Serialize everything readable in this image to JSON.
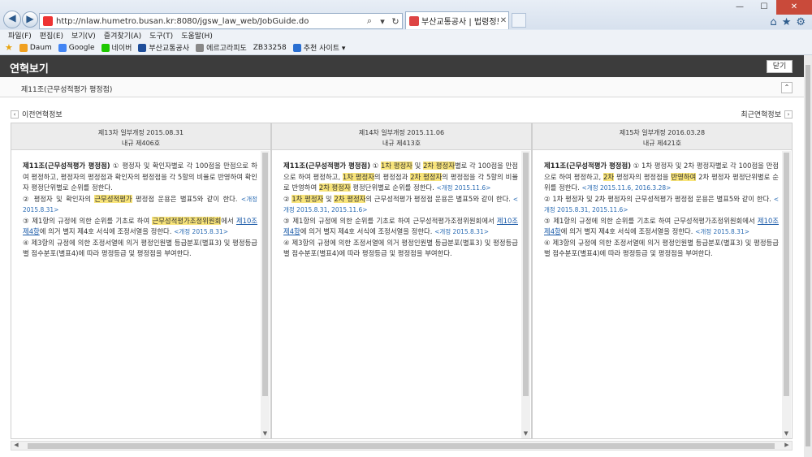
{
  "browser": {
    "url": "http://nlaw.humetro.busan.kr:8080/jgsw_law_web/JobGuide.do",
    "tab_label": "부산교통공사 | 법령정보서...",
    "menu": [
      "파일(F)",
      "편집(E)",
      "보기(V)",
      "즐겨찾기(A)",
      "도구(T)",
      "도움말(H)"
    ],
    "favorites": [
      {
        "label": "Daum",
        "color": "#f0a020"
      },
      {
        "label": "Google",
        "color": "#4285f4"
      },
      {
        "label": "네이버",
        "color": "#1ec800"
      },
      {
        "label": "부산교통공사",
        "color": "#1f4e9a"
      },
      {
        "label": "에르고라피도",
        "color": "#888888"
      },
      {
        "label": "ZB33258",
        "color": "#ffffff"
      },
      {
        "label": "추천 사이트 ▾",
        "color": "#2a6fd1"
      }
    ]
  },
  "page": {
    "title": "연혁보기",
    "close_label": "닫기",
    "article_title": "제11조(근무성적평가 평정점)",
    "prev_label": "이전연혁정보",
    "next_label": "최근연혁정보"
  },
  "columns": [
    {
      "head1": "제13차 일부개정 2015.08.31",
      "head2": "내규 제406호"
    },
    {
      "head1": "제14차 일부개정 2015.11.06",
      "head2": "내규 제413호"
    },
    {
      "head1": "제15차 일부개정 2016.03.28",
      "head2": "내규 제421호"
    }
  ],
  "texts": {
    "art": "제11조(근무성적평가 평정점)",
    "c1_p1": "① 평정자 및 확인자별로 각 100점을 만점으로 하여 평정하고, 평정자의 평정점과 확인자의 평정점을 각 5할의 비율로 반영하여 확인자 평정단위별로 순위를 정한다.",
    "c1_p2a": "② 평정자 및 확인자의",
    "c1_p2hl": "근무성적평가",
    "c1_p2b": "평정점 운용은 별표5와 같이 한다.",
    "rev_2015_08_31": "<개정 2015.8.31>",
    "c1_p3a": "③ 제1항의 규정에 의한 순위를 기초로 하여",
    "c1_p3hl": "근무성적평가조정위원회",
    "c1_p3b": "에서",
    "link_10_4": "제10조 제4항",
    "c1_p3c": "에 의거 별지 제4호 서식에 조정서열을 정한다.",
    "p4": "④ 제3항의 규정에 의한 조정서열에 의거 평정인원별 등급분포(별표3) 및 평정등급별 점수분포(별표4)에 따라 평정등급 및 평정점을 부여한다.",
    "c2_p1a": "①",
    "hl_1st": "1차 평정자",
    "c2_and": "및",
    "hl_2nd": "2차 평정자",
    "c2_p1b": "별로 각 100점을 만점으로 하여 평정하고,",
    "c2_p1c": "의 평정점과",
    "hl_2nd_b": "2차 평정자",
    "c2_p1d": "의 평정점을 각 5할의 비율로 반영하여",
    "c2_p1e": "평정단위별로 순위를 정한다.",
    "rev_2015_11_6": "<개정 2015.11.6>",
    "c2_p2a": "②",
    "c2_p2b": "의 근무성적평가 평정점 운용은 별표5와 같이 한다.",
    "rev_2015_both": "<개정 2015.8.31, 2015.11.6>",
    "c2_p3": "③ 제1항의 규정에 의한 순위를 기초로 하여 근무성적평가조정위원회에서",
    "c2_p3c": "에 의거 별지 제4호 서식에 조정서열을 정한다.",
    "c3_p1a": "① 1차 평정자 및 2차 평정자별로 각 100점을 만점으로 하여 평정하고,",
    "c3_hl_2nd": "2차",
    "c3_p1b": "평정자의 평정점을",
    "c3_hl_ban": "반영하여",
    "c3_p1c": "2차 평정자 평정단위별로 순위를 정한다.",
    "rev_2016": "<개정 2015.11.6, 2016.3.28>",
    "c3_p2": "② 1차 평정자 및 2차 평정자의 근무성적평가 평정점 운용은 별표5와 같이 한다.",
    "c3_p3": "③ 제1항의 규정에 의한 순위를 기초로 하여 근무성적평가조정위원회에서",
    "c3_p3c": "에 의거 별지 제4호 서식에 조정서열을 정한다."
  }
}
